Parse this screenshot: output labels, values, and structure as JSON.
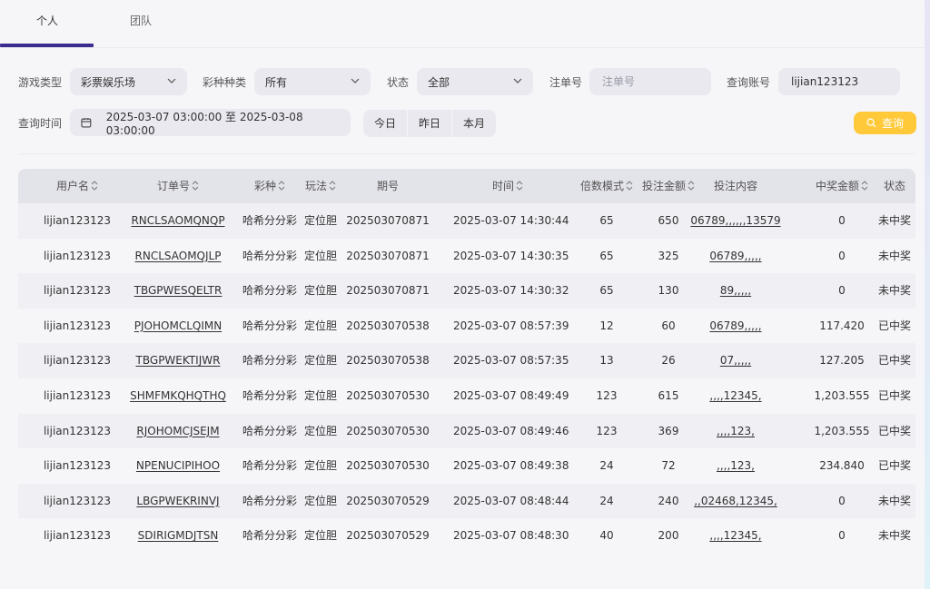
{
  "tabs": [
    {
      "label": "个人",
      "active": true
    },
    {
      "label": "团队",
      "active": false
    }
  ],
  "filters": {
    "game_type": {
      "label": "游戏类型",
      "value": "彩票娱乐场"
    },
    "lottery_type": {
      "label": "彩种种类",
      "value": "所有"
    },
    "status": {
      "label": "状态",
      "value": "全部"
    },
    "order_no": {
      "label": "注单号",
      "placeholder": "注单号"
    },
    "account": {
      "label": "查询账号",
      "value": "lijian123123"
    },
    "time": {
      "label": "查询时间",
      "value": "2025-03-07 03:00:00 至 2025-03-08 03:00:00"
    },
    "quick": [
      "今日",
      "昨日",
      "本月"
    ],
    "query_button": "查询"
  },
  "table": {
    "columns": [
      "用户名",
      "订单号",
      "彩种",
      "玩法",
      "期号",
      "时间",
      "倍数模式",
      "投注金额",
      "投注内容",
      "中奖金额",
      "状态"
    ],
    "rows": [
      [
        "lijian123123",
        "RNCLSAOMQNQP",
        "哈希分分彩",
        "定位胆",
        "202503070871",
        "2025-03-07 14:30:44",
        "65",
        "650",
        "06789,,,,,,13579",
        "0",
        "未中奖"
      ],
      [
        "lijian123123",
        "RNCLSAOMQJLP",
        "哈希分分彩",
        "定位胆",
        "202503070871",
        "2025-03-07 14:30:35",
        "65",
        "325",
        "06789,,,,,",
        "0",
        "未中奖"
      ],
      [
        "lijian123123",
        "TBGPWESQELTR",
        "哈希分分彩",
        "定位胆",
        "202503070871",
        "2025-03-07 14:30:32",
        "65",
        "130",
        "89,,,,,",
        "0",
        "未中奖"
      ],
      [
        "lijian123123",
        "PJOHOMCLQIMN",
        "哈希分分彩",
        "定位胆",
        "202503070538",
        "2025-03-07 08:57:39",
        "12",
        "60",
        "06789,,,,,",
        "117.420",
        "已中奖"
      ],
      [
        "lijian123123",
        "TBGPWEKTIJWR",
        "哈希分分彩",
        "定位胆",
        "202503070538",
        "2025-03-07 08:57:35",
        "13",
        "26",
        "07,,,,,",
        "127.205",
        "已中奖"
      ],
      [
        "lijian123123",
        "SHMFMKQHQTHQ",
        "哈希分分彩",
        "定位胆",
        "202503070530",
        "2025-03-07 08:49:49",
        "123",
        "615",
        ",,,,12345,",
        "1,203.555",
        "已中奖"
      ],
      [
        "lijian123123",
        "RJOHOMCJSEJM",
        "哈希分分彩",
        "定位胆",
        "202503070530",
        "2025-03-07 08:49:46",
        "123",
        "369",
        ",,,,123,",
        "1,203.555",
        "已中奖"
      ],
      [
        "lijian123123",
        "NPENUCIPIHOO",
        "哈希分分彩",
        "定位胆",
        "202503070530",
        "2025-03-07 08:49:38",
        "24",
        "72",
        ",,,,123,",
        "234.840",
        "已中奖"
      ],
      [
        "lijian123123",
        "LBGPWEKRINVJ",
        "哈希分分彩",
        "定位胆",
        "202503070529",
        "2025-03-07 08:48:44",
        "24",
        "240",
        ",,02468,12345,",
        "0",
        "未中奖"
      ],
      [
        "lijian123123",
        "SDIRIGMDJTSN",
        "哈希分分彩",
        "定位胆",
        "202503070529",
        "2025-03-07 08:48:30",
        "40",
        "200",
        ",,,,12345,",
        "0",
        "未中奖"
      ]
    ]
  }
}
